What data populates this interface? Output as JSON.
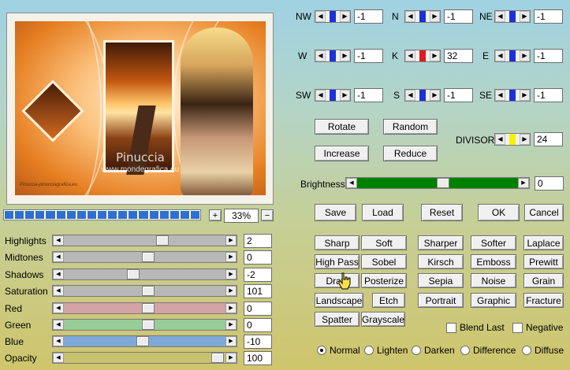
{
  "preview": {
    "watermark_title": "Pinuccia",
    "watermark_url": "www.mondegrafica.eu",
    "signature_text": "Pinuccia-pinucciagrafica.eu"
  },
  "progress": {
    "segments": 19
  },
  "zoom": {
    "plus": "+",
    "minus": "−",
    "value": "33%"
  },
  "kernel": {
    "nw": {
      "label": "NW",
      "value": "-1"
    },
    "n": {
      "label": "N",
      "value": "-1"
    },
    "ne": {
      "label": "NE",
      "value": "-1"
    },
    "w": {
      "label": "W",
      "value": "-1"
    },
    "k": {
      "label": "K",
      "value": "32"
    },
    "e": {
      "label": "E",
      "value": "-1"
    },
    "sw": {
      "label": "SW",
      "value": "-1"
    },
    "s": {
      "label": "S",
      "value": "-1"
    },
    "se": {
      "label": "SE",
      "value": "-1"
    }
  },
  "ops": {
    "rotate": "Rotate",
    "random": "Random",
    "increase": "Increase",
    "reduce": "Reduce"
  },
  "divisor": {
    "label": "DIVISOR",
    "value": "24"
  },
  "brightness": {
    "label": "Brightness",
    "value": "0",
    "level": 0.53,
    "track_color": "#008000"
  },
  "actions": {
    "save": "Save",
    "load": "Load",
    "reset": "Reset",
    "ok": "OK",
    "cancel": "Cancel"
  },
  "filters": {
    "row1": [
      "Sharp",
      "Soft",
      "Sharper",
      "Softer",
      "Laplace"
    ],
    "row2": [
      "High Pass",
      "Sobel",
      "Kirsch",
      "Emboss",
      "Prewitt"
    ],
    "row3": [
      "Draw",
      "Posterize",
      "Sepia",
      "Noise",
      "Grain"
    ],
    "row4": [
      "Landscape",
      "Etch",
      "Portrait",
      "Graphic",
      "Fracture"
    ],
    "row5": [
      "Spatter",
      "Grayscale"
    ]
  },
  "options": {
    "blend_last": "Blend Last",
    "negative": "Negative"
  },
  "blend_modes": {
    "normal": "Normal",
    "lighten": "Lighten",
    "darken": "Darken",
    "difference": "Difference",
    "diffuse": "Diffuse",
    "selected": "normal"
  },
  "adjustments": {
    "highlights": {
      "label": "Highlights",
      "value": "2",
      "level": 0.61,
      "color": "#b8b8b8"
    },
    "midtones": {
      "label": "Midtones",
      "value": "0",
      "level": 0.52,
      "color": "#b8b8b8"
    },
    "shadows": {
      "label": "Shadows",
      "value": "-2",
      "level": 0.42,
      "color": "#b8b8b8"
    },
    "saturation": {
      "label": "Saturation",
      "value": "101",
      "level": 0.52,
      "color": "#b8b8b8"
    },
    "red": {
      "label": "Red",
      "value": "0",
      "level": 0.52,
      "color": "#d4a3a3"
    },
    "green": {
      "label": "Green",
      "value": "0",
      "level": 0.52,
      "color": "#98cc98"
    },
    "blue": {
      "label": "Blue",
      "value": "-10",
      "level": 0.48,
      "color": "#7fa9d8"
    },
    "opacity": {
      "label": "Opacity",
      "value": "100",
      "level": 0.98,
      "color": "#c8c26c"
    }
  }
}
